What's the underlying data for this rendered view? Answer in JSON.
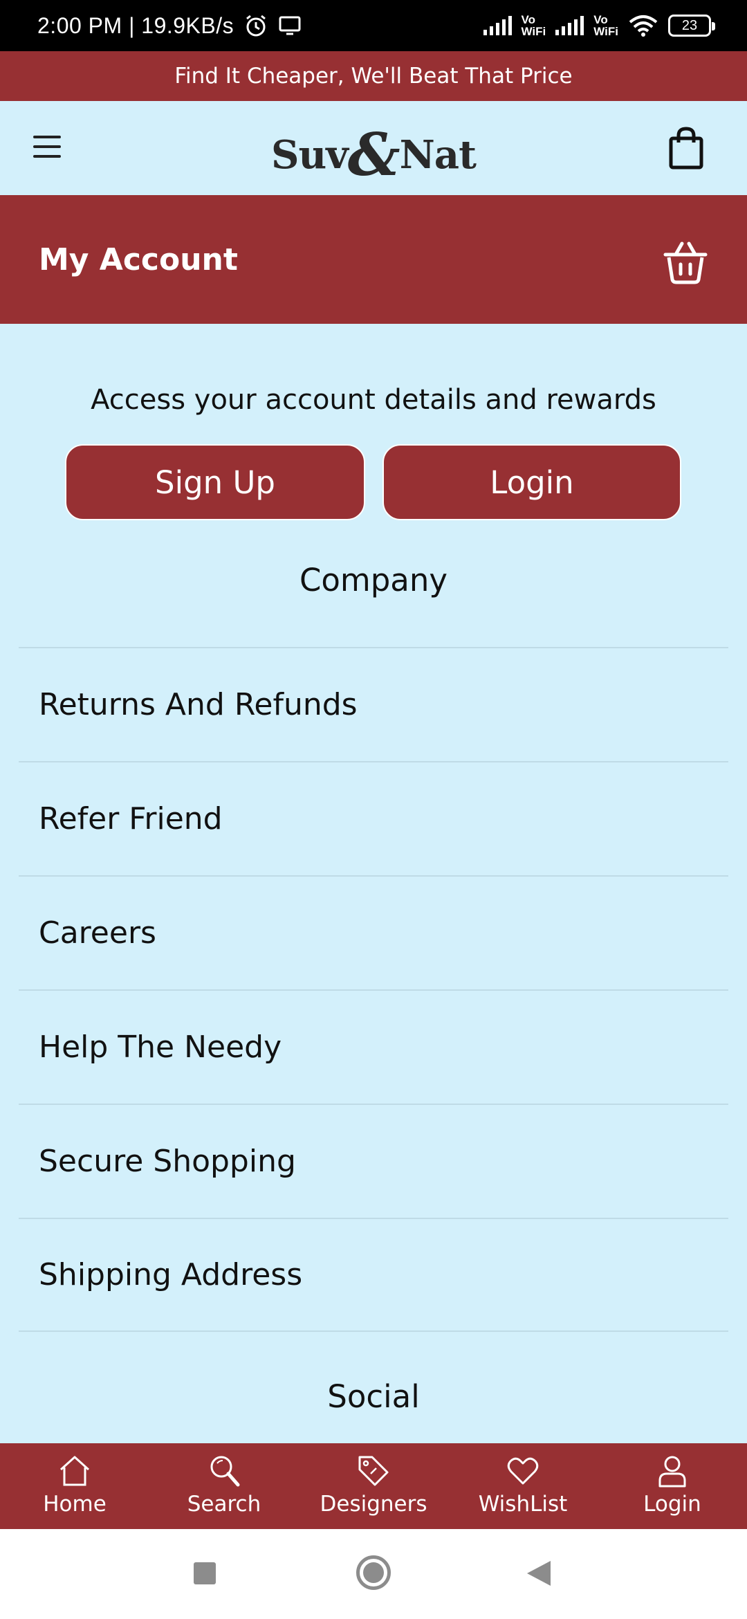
{
  "status_bar": {
    "time_speed": "2:00 PM | 19.9KB/s",
    "vowifi_1": "Vo\nWiFi",
    "vowifi_2": "Vo\nWiFi",
    "battery": "23"
  },
  "promo": {
    "text": "Find It Cheaper, We'll Beat That Price"
  },
  "header": {
    "logo_left": "Suv",
    "logo_amp": "&",
    "logo_right": "Nat"
  },
  "account": {
    "title": "My Account",
    "access_text": "Access your account details and rewards",
    "signup_label": "Sign Up",
    "login_label": "Login"
  },
  "company": {
    "title": "Company",
    "links": [
      "Returns And Refunds",
      "Refer Friend",
      "Careers",
      "Help The Needy",
      "Secure Shopping",
      "Shipping Address"
    ]
  },
  "social": {
    "title": "Social"
  },
  "bottom_nav": [
    {
      "label": "Home",
      "icon": "home-icon"
    },
    {
      "label": "Search",
      "icon": "search-icon"
    },
    {
      "label": "Designers",
      "icon": "tag-icon"
    },
    {
      "label": "WishList",
      "icon": "heart-icon"
    },
    {
      "label": "Login",
      "icon": "user-icon"
    }
  ],
  "colors": {
    "brand": "#973033",
    "background": "#d3f0fb"
  }
}
